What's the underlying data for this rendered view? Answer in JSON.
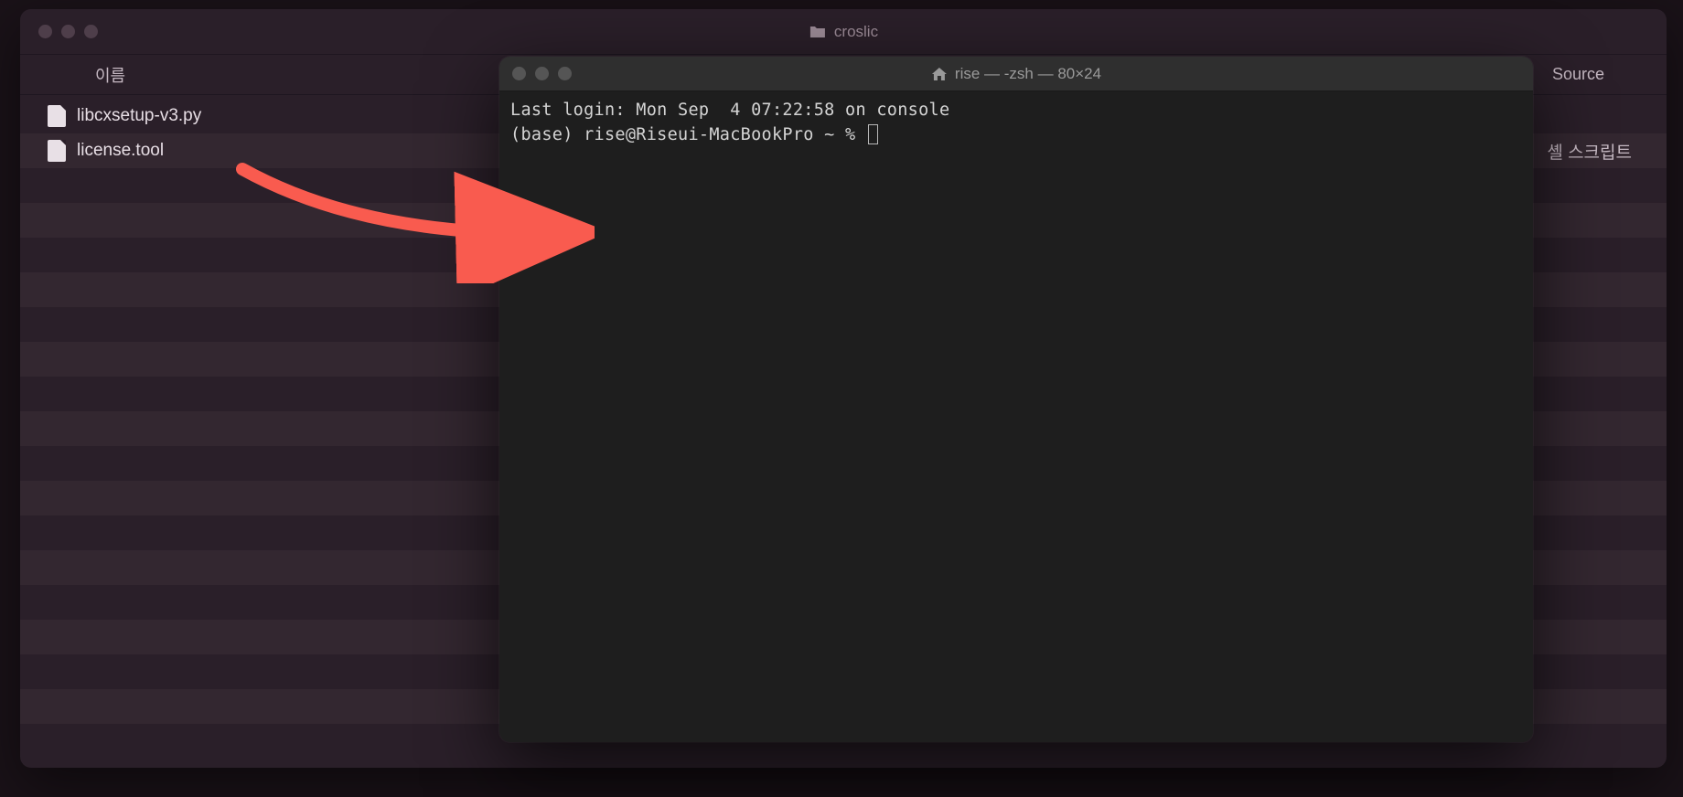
{
  "finder": {
    "title": "croslic",
    "column_header_name": "이름",
    "column_header_source": "Source",
    "files": [
      {
        "name": "libcxsetup-v3.py",
        "kind": ""
      },
      {
        "name": "license.tool",
        "kind": "셸 스크립트"
      }
    ]
  },
  "terminal": {
    "title": "rise — -zsh — 80×24",
    "line1": "Last login: Mon Sep  4 07:22:58 on console",
    "prompt": "(base) rise@Riseui-MacBookPro ~ % "
  }
}
